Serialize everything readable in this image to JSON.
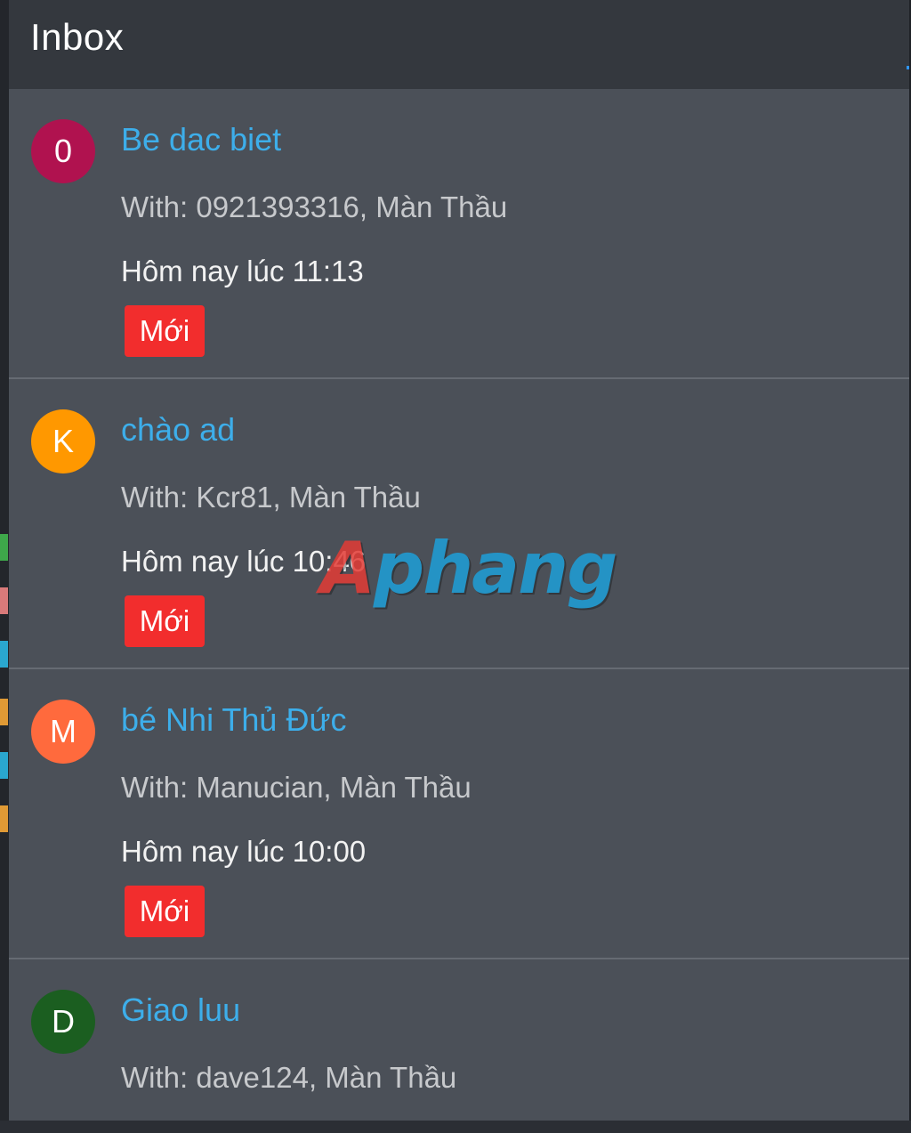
{
  "header": {
    "title": "Inbox"
  },
  "colors": {
    "panel_bg": "#4b5058",
    "header_bg": "#34383e",
    "title_blue": "#3daeea",
    "badge_red": "#f22d2d"
  },
  "inbox": {
    "items": [
      {
        "avatar_letter": "0",
        "avatar_color": "#b0124f",
        "title": "Be dac biet",
        "with": "With: 0921393316, Màn Thầu",
        "time": "Hôm nay lúc 11:13",
        "badge": "Mới"
      },
      {
        "avatar_letter": "K",
        "avatar_color": "#ff9800",
        "title": "chào ad",
        "with": "With: Kcr81, Màn Thầu",
        "time": "Hôm nay lúc 10:46",
        "badge": "Mới"
      },
      {
        "avatar_letter": "M",
        "avatar_color": "#ff6a3d",
        "title": "bé Nhi Thủ Đức",
        "with": "With: Manucian, Màn Thầu",
        "time": "Hôm nay lúc 10:00",
        "badge": "Mới"
      },
      {
        "avatar_letter": "D",
        "avatar_color": "#1b5e20",
        "title": "Giao luu",
        "with": "With: dave124, Màn Thầu"
      }
    ]
  },
  "watermark": {
    "first": "A",
    "rest": "phang"
  }
}
